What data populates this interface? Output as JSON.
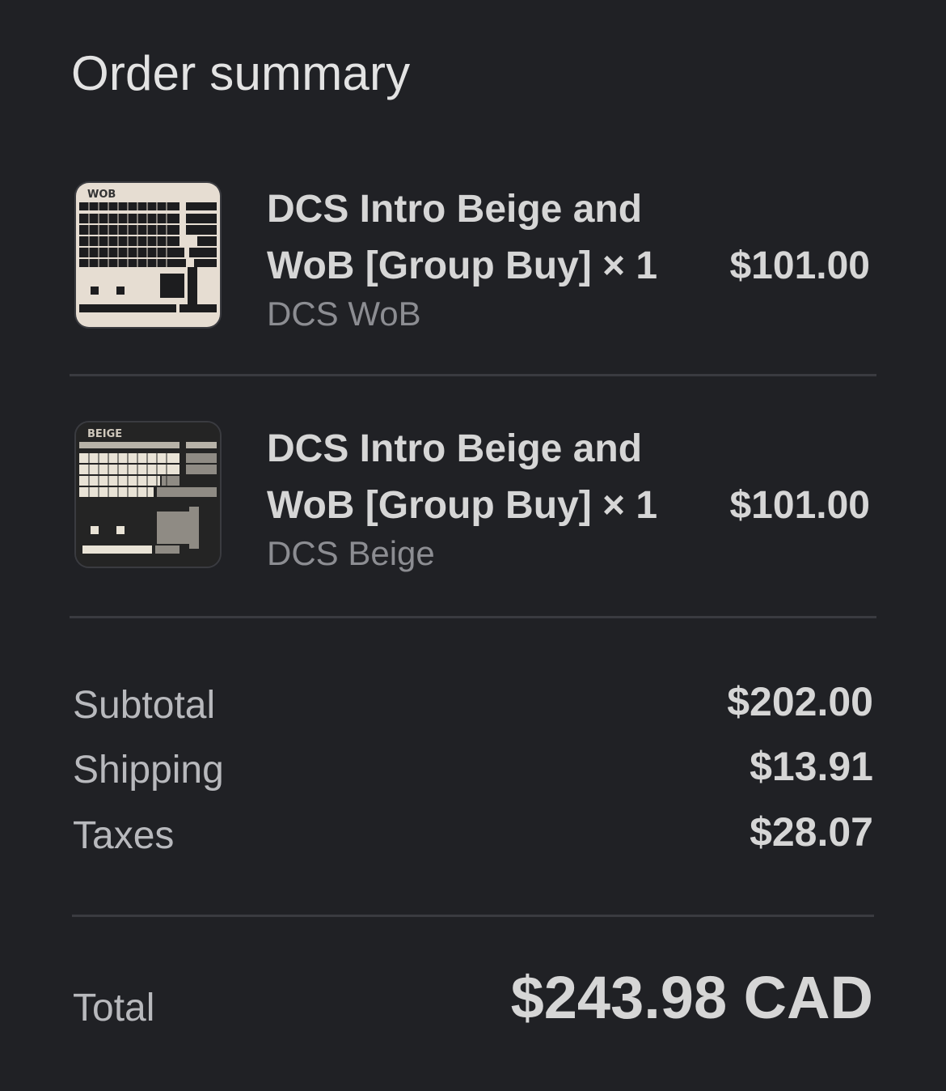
{
  "title": "Order summary",
  "items": [
    {
      "name_line1": "DCS Intro Beige and",
      "name_line2": "WoB [Group Buy] × 1",
      "variant": "DCS WoB",
      "price": "$101.00",
      "thumb_label": "WOB",
      "thumb_icon": "keyboard-keycaps-image-wob"
    },
    {
      "name_line1": "DCS Intro Beige and",
      "name_line2": "WoB [Group Buy] × 1",
      "variant": "DCS Beige",
      "price": "$101.00",
      "thumb_label": "BEIGE",
      "thumb_icon": "keyboard-keycaps-image-beige"
    }
  ],
  "summary": {
    "subtotal_label": "Subtotal",
    "subtotal_value": "$202.00",
    "shipping_label": "Shipping",
    "shipping_value": "$13.91",
    "taxes_label": "Taxes",
    "taxes_value": "$28.07"
  },
  "total": {
    "label": "Total",
    "value": "$243.98 CAD"
  },
  "colors": {
    "background": "#202125",
    "text_primary": "#d6d6d6",
    "text_secondary": "#8c8d92",
    "divider": "#3a3b40"
  }
}
